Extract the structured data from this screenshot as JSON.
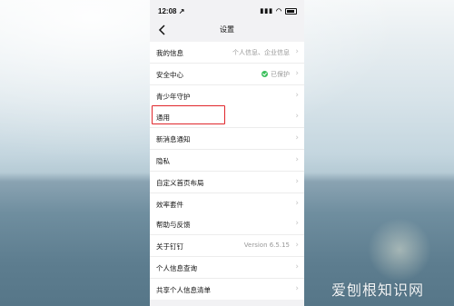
{
  "status_bar": {
    "time": "12:08",
    "location_arrow": "↗"
  },
  "nav": {
    "title": "设置"
  },
  "sections": [
    {
      "rows": [
        {
          "label": "我的信息",
          "value": "个人信息、企业信息"
        },
        {
          "label": "安全中心",
          "value": "已保护",
          "icon": "shield-icon"
        },
        {
          "label": "青少年守护",
          "value": ""
        }
      ]
    },
    {
      "rows": [
        {
          "label": "通用",
          "value": ""
        },
        {
          "label": "新消息通知",
          "value": ""
        },
        {
          "label": "隐私",
          "value": ""
        },
        {
          "label": "自定义首页布局",
          "value": ""
        },
        {
          "label": "效率套件",
          "value": ""
        }
      ]
    },
    {
      "rows": [
        {
          "label": "帮助与反馈",
          "value": ""
        },
        {
          "label": "关于钉钉",
          "value": "Version 6.5.15"
        },
        {
          "label": "个人信息查询",
          "value": ""
        },
        {
          "label": "共享个人信息清单",
          "value": ""
        }
      ]
    }
  ],
  "watermark": {
    "text": "爱刨根知识网"
  },
  "colors": {
    "highlight": "#e0262b",
    "protected_green": "#3bbf5c"
  }
}
